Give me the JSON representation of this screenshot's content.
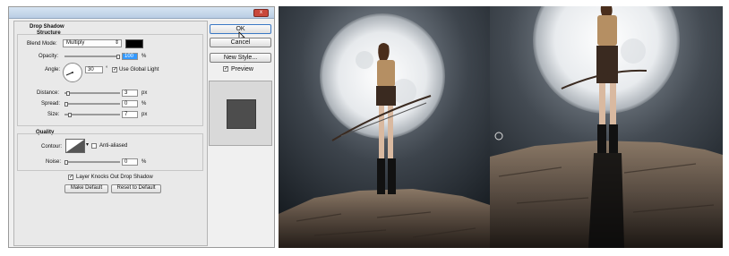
{
  "dialog": {
    "section_title": "Drop Shadow",
    "structure_label": "Structure",
    "blend_mode_label": "Blend Mode:",
    "blend_mode_value": "Multiply",
    "opacity_label": "Opacity:",
    "opacity_value": "100",
    "angle_label": "Angle:",
    "angle_value": "30",
    "degree_symbol": "°",
    "use_global_light_label": "Use Global Light",
    "distance_label": "Distance:",
    "distance_value": "3",
    "spread_label": "Spread:",
    "spread_value": "0",
    "size_label": "Size:",
    "size_value": "7",
    "unit_px": "px",
    "unit_percent": "%",
    "quality_label": "Quality",
    "contour_label": "Contour:",
    "anti_aliased_label": "Anti-aliased",
    "noise_label": "Noise:",
    "noise_value": "0",
    "knockout_label": "Layer Knocks Out Drop Shadow",
    "make_default_label": "Make Default",
    "reset_default_label": "Reset to Default",
    "close_label": "x"
  },
  "side": {
    "ok_label": "OK",
    "cancel_label": "Cancel",
    "new_style_label": "New Style...",
    "preview_label": "Preview",
    "check_mark": "✓"
  },
  "colors": {
    "shadow_color": "#000000",
    "selection": "#3399ff"
  },
  "icons": {
    "close": "close-icon",
    "cursor": "mouse-cursor-icon",
    "dropdown": "chevron-down-icon"
  }
}
